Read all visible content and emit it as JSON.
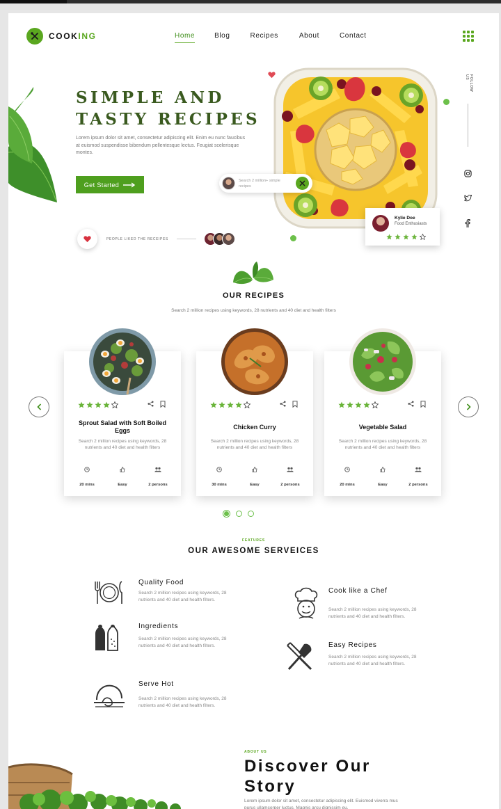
{
  "brand": {
    "name_main": "COOK",
    "name_accent": "ING"
  },
  "nav": [
    {
      "label": "Home",
      "active": true
    },
    {
      "label": "Blog",
      "active": false
    },
    {
      "label": "Recipes",
      "active": false
    },
    {
      "label": "About",
      "active": false
    },
    {
      "label": "Contact",
      "active": false
    }
  ],
  "hero": {
    "title": "SIMPLE AND\nTASTY RECIPES",
    "description": "Lorem ipsum dolor sit amet, consectetur adipiscing elit. Enim eu nunc faucibus at euismod suspendisse bibendum pellentesque lectus. Feugiat scelerisque montes.",
    "cta_label": "Get Started",
    "search_pill_text": "Search 2 million+ simple recipes",
    "liked_label": "PEOPLE LIKED THE RECEIPES",
    "review": {
      "name": "Kylie Doe",
      "role": "Food Enthusiasts",
      "rating": 4
    }
  },
  "follow": {
    "label": "FOLLOW US",
    "icons": [
      "instagram-icon",
      "twitter-icon",
      "facebook-icon"
    ]
  },
  "recipes": {
    "title": "OUR RECIPES",
    "subtitle": "Search 2 million recipes using keywords, 28 nutrients and 40 diet and health filters",
    "cards": [
      {
        "title": "Sprout Salad with Soft Boiled Eggs",
        "desc": "Search 2 million recipes using keywords, 28 nutrients and 40 diet and health filters",
        "time": "20 mins",
        "level": "Easy",
        "persons": "2 persons",
        "rating": 4
      },
      {
        "title": "Chicken Curry",
        "desc": "Search 2 million recipes using keywords, 28 nutrients and 40 diet and health filters",
        "time": "30 mins",
        "level": "Easy",
        "persons": "2 persons",
        "rating": 4
      },
      {
        "title": "Vegetable Salad",
        "desc": "Search 2 million recipes using keywords, 28 nutrients and 40 diet and health filters",
        "time": "20 mins",
        "level": "Easy",
        "persons": "2 persons",
        "rating": 4
      }
    ],
    "page_count": 3,
    "active_page": 1
  },
  "features": {
    "kicker": "FEATURES",
    "title": "OUR AWESOME SERVEICES",
    "items": [
      {
        "title": "Quality Food",
        "desc": "Search 2 million recipes using keywords, 28 nutrients and 40 diet and health filters.",
        "icon": "plate-cutlery-icon"
      },
      {
        "title": "Ingredients",
        "desc": "Search 2 million recipes using keywords, 28 nutrients and 40 diet and health filters.",
        "icon": "salt-pepper-icon"
      },
      {
        "title": "Serve Hot",
        "desc": "Search 2 million recipes using keywords, 28 nutrients and 40 diet and health filters.",
        "icon": "cloche-icon"
      },
      {
        "title": "Cook like a Chef",
        "desc": "Search 2 million recipes using keywords, 28 nutrients and 40 diet and health filters.",
        "icon": "chef-icon"
      },
      {
        "title": "Easy Recipes",
        "desc": "Search 2 million recipes using keywords, 28 nutrients and 40 diet and health filters.",
        "icon": "spatula-fork-icon"
      }
    ]
  },
  "about": {
    "kicker": "ABOUT US",
    "title": "Discover Our\nStory",
    "text": "Lorem ipsum dolor sit amet, consectetur adipiscing elit. Euismod viverra mus purus ullamcorper luctus. Magnis arcu dignissim eu."
  },
  "colors": {
    "accent": "#5aa71f",
    "title_green": "#3a5a1f",
    "text": "#111111",
    "muted": "#888888"
  }
}
